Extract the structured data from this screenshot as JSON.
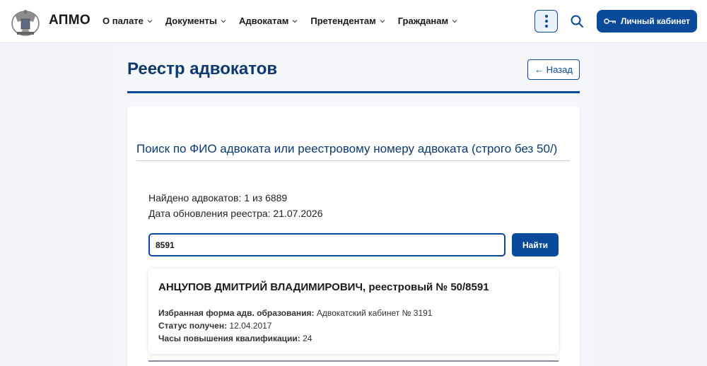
{
  "header": {
    "brand": "АПМО",
    "nav": [
      {
        "label": "О палате"
      },
      {
        "label": "Документы"
      },
      {
        "label": "Адвокатам"
      },
      {
        "label": "Претендентам"
      },
      {
        "label": "Гражданам"
      }
    ],
    "account_label": "Личный кабинет"
  },
  "page": {
    "title": "Реестр адвокатов",
    "back_label": "← Назад"
  },
  "search": {
    "heading": "Поиск по ФИО адвоката или реестровому номеру адвоката (строго без 50/)",
    "found_text": "Найдено адвокатов: 1 из 6889",
    "updated_text": "Дата обновления реестра: 21.07.2026",
    "input_value": "8591",
    "find_label": "Найти"
  },
  "result": {
    "name": "АНЦУПОВ ДМИТРИЙ ВЛАДИМИРОВИЧ, реестровый № 50/8591",
    "rows": [
      {
        "label": "Избранная форма адв. образования:",
        "value": " Адвокатский кабинет № 3191"
      },
      {
        "label": "Статус получен:",
        "value": " 12.04.2017"
      },
      {
        "label": "Часы повышения квалификации:",
        "value": " 24"
      }
    ]
  },
  "colors": {
    "accent": "#0a4a9a",
    "title": "#0d3a6e"
  }
}
